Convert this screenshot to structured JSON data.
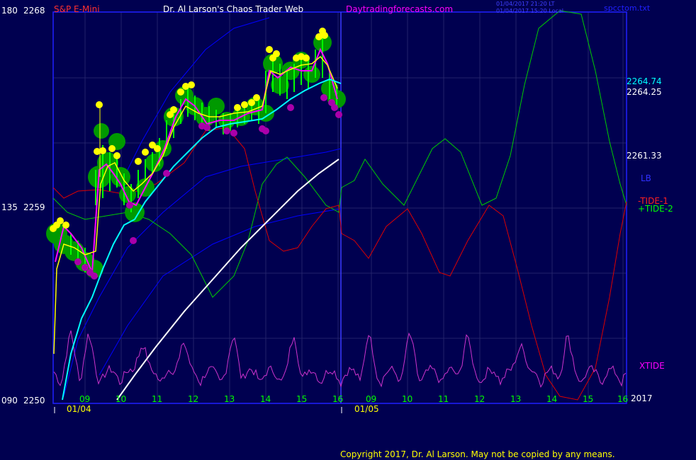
{
  "header": {
    "scale_top": "180",
    "price_top": "2268",
    "instrument": "S&P E-Mini",
    "author": "Dr. Al Larson's Chaos Trader Web",
    "site": "Daytradingforecasts.com",
    "stamp1": "01/04/2017 21:20 LT",
    "stamp2": "01/04/2017 15:20 Local",
    "file": "spcctom.txt"
  },
  "axis_left": {
    "mid_scale": "135",
    "mid_price": "2259",
    "bot_scale": "090",
    "bot_price": "2250"
  },
  "right_labels": {
    "price1": "2264.74",
    "price2": "2264.25",
    "price3": "2261.33",
    "lb": "LB",
    "tide1": "-TIDE-1",
    "tide2": "+TIDE-2",
    "xtide": "XTIDE",
    "year": "2017"
  },
  "x_hours_day1": [
    "09",
    "10",
    "11",
    "12",
    "13",
    "14",
    "15",
    "16"
  ],
  "x_hours_day2": [
    "09",
    "10",
    "11",
    "12",
    "13",
    "14",
    "15",
    "16"
  ],
  "dates": [
    "01/04",
    "01/05"
  ],
  "copyright": "Copyright 2017, Dr. Al Larson. May not be copied by any means.",
  "colors": {
    "background": "#000050",
    "frame": "#2020ff",
    "price_bars": "#00ff00",
    "bubbles": "#009900",
    "highs": "#ffff00",
    "lows": "#aa00aa",
    "fast_avg": "#ffff00",
    "mid_avg": "#ff00ff",
    "cyan_avg": "#00ffff",
    "white_avg": "#ffffff",
    "tide1": "#dd0000",
    "tide2": "#00cc00",
    "xtide": "#cc33cc",
    "bands": "#0000ff"
  },
  "chart_data": {
    "type": "line",
    "title": "S&P E-Mini",
    "y_price_range": [
      2250,
      2268
    ],
    "y_scale_range": [
      90,
      180
    ],
    "x_days": [
      "01/04",
      "01/05"
    ],
    "x_hour_ticks": [
      "09",
      "10",
      "11",
      "12",
      "13",
      "14",
      "15",
      "16"
    ],
    "last_prices": [
      2264.74,
      2264.25,
      2261.33
    ],
    "series": [
      {
        "name": "S&P E-Mini",
        "type": "price",
        "x_hour": [
          8.5,
          9.0,
          9.5,
          10.0,
          10.5,
          11.0,
          11.5,
          12.0,
          12.5,
          13.0,
          13.5,
          14.0,
          14.5,
          15.0,
          15.5,
          16.0
        ],
        "values": [
          2256.9,
          2255.3,
          2262.1,
          2259.5,
          2261.8,
          2264.5,
          2265.6,
          2264.0,
          2264.3,
          2264.7,
          2265.3,
          2267.0,
          2266.6,
          2267.4,
          2266.8,
          2264.5
        ]
      },
      {
        "name": "-TIDE-1",
        "type": "oscillator"
      },
      {
        "name": "+TIDE-2",
        "type": "oscillator"
      },
      {
        "name": "XTIDE",
        "type": "oscillator"
      },
      {
        "name": "LB",
        "type": "band"
      }
    ]
  }
}
